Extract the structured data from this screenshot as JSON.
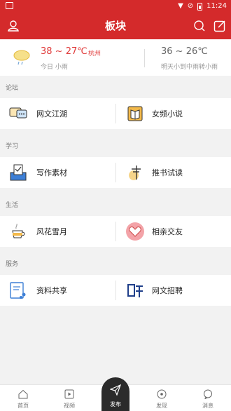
{
  "status_bar": {
    "time": "11:24"
  },
  "header": {
    "title": "板块",
    "left_icon": "user-icon",
    "right_icons": [
      "search-icon",
      "edit-icon"
    ]
  },
  "weather": {
    "today_temp": "38 ~ 27℃",
    "city": "杭州",
    "today_desc": "今日 小雨",
    "tomorrow_temp": "36 ~ 26℃",
    "tomorrow_desc": "明天小到中雨转小雨"
  },
  "sections": [
    {
      "label": "论坛",
      "items": [
        {
          "label": "网文江湖",
          "icon": "chat-icon"
        },
        {
          "label": "女频小说",
          "icon": "book-icon"
        }
      ]
    },
    {
      "label": "学习",
      "items": [
        {
          "label": "写作素材",
          "icon": "writing-icon"
        },
        {
          "label": "推书试读",
          "icon": "recommend-icon"
        }
      ]
    },
    {
      "label": "生活",
      "items": [
        {
          "label": "风花雪月",
          "icon": "tea-icon"
        },
        {
          "label": "相亲交友",
          "icon": "heart-icon"
        }
      ]
    },
    {
      "label": "服务",
      "items": [
        {
          "label": "资料共享",
          "icon": "share-icon"
        },
        {
          "label": "网文招聘",
          "icon": "recruit-icon"
        }
      ]
    }
  ],
  "bottom_nav": {
    "tabs": [
      {
        "label": "首页",
        "icon": "home-icon"
      },
      {
        "label": "视频",
        "icon": "video-icon"
      },
      {
        "label": "发布",
        "icon": "send-icon"
      },
      {
        "label": "发现",
        "icon": "discover-icon"
      },
      {
        "label": "消息",
        "icon": "message-icon"
      }
    ]
  },
  "colors": {
    "brand": "#d42a2b",
    "accent_red": "#e03b3b"
  }
}
